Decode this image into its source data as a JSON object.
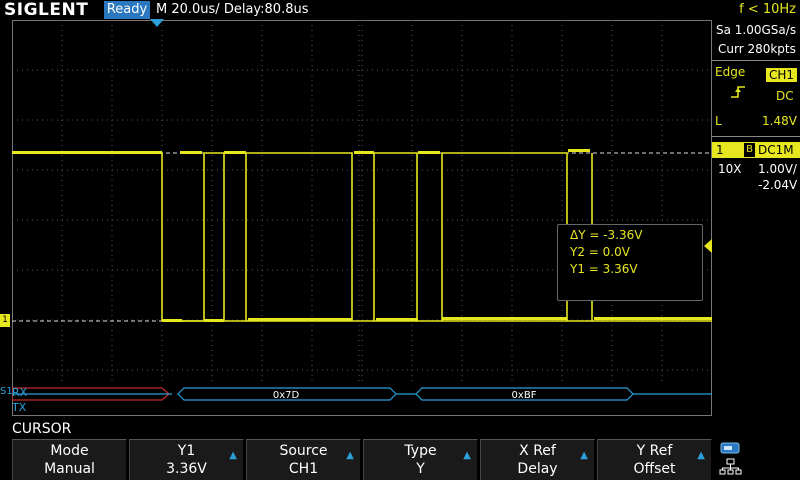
{
  "header": {
    "brand": "SIGLENT",
    "run_state": "Ready",
    "timebase": "M 20.0us/  Delay:80.8us",
    "trigger_freq": "f < 10Hz"
  },
  "acquisition": {
    "sample_rate": "Sa 1.00GSa/s",
    "memory": "Curr 280kpts"
  },
  "trigger": {
    "type": "Edge",
    "source": "CH1",
    "coupling": "DC",
    "level_label": "L",
    "level": "1.48V"
  },
  "channel": {
    "number": "1",
    "bw_flag": "B",
    "coupling": "DC1M",
    "probe": "10X",
    "scale": "1.00V/",
    "offset": "-2.04V"
  },
  "cursor_readout": {
    "delta_y": "ΔY = -3.36V",
    "y2": "Y2 = 0.0V",
    "y1": "Y1 = 3.36V"
  },
  "decode": {
    "bus_label": "S1",
    "rx_label": "RX",
    "tx_label": "TX",
    "tx_bytes": [
      "0x7D",
      "0xBF"
    ]
  },
  "channel_marker": "1",
  "menu": {
    "title": "CURSOR",
    "softkeys": [
      {
        "label": "Mode",
        "value": "Manual",
        "arrow": false
      },
      {
        "label": "Y1",
        "value": "3.36V",
        "arrow": true
      },
      {
        "label": "Source",
        "value": "CH1",
        "arrow": true
      },
      {
        "label": "Type",
        "value": "Y",
        "arrow": true
      },
      {
        "label": "X Ref",
        "value": "Delay",
        "arrow": true
      },
      {
        "label": "Y Ref",
        "value": "Offset",
        "arrow": true
      }
    ]
  },
  "colors": {
    "trace": "#e7e720",
    "decode": "#2a9fd8",
    "error": "#c0282a",
    "accent": "#2a78c0"
  },
  "icons": {
    "usb": "usb-icon",
    "network": "network-icon",
    "trigger_edge": "rising-edge-icon"
  }
}
